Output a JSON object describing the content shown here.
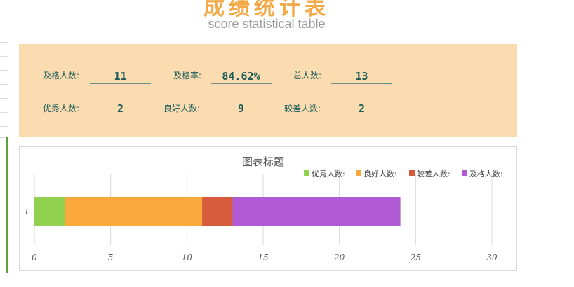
{
  "header": {
    "title": "成绩统计表",
    "subtitle": "score statistical table"
  },
  "stats": {
    "row1": [
      {
        "label": "及格人数:",
        "value": "11"
      },
      {
        "label": "及格率:",
        "value": "84.62%"
      },
      {
        "label": "总人数:",
        "value": "13"
      }
    ],
    "row2": [
      {
        "label": "优秀人数:",
        "value": "2"
      },
      {
        "label": "良好人数:",
        "value": "9"
      },
      {
        "label": "较差人数:",
        "value": "2"
      }
    ]
  },
  "colors": {
    "title": "#f4a947",
    "panel_background": "#fbdcb0",
    "stat_text": "#1d5c5a",
    "series": [
      "#92d050",
      "#f9a93b",
      "#d65a3c",
      "#b05ad6"
    ]
  },
  "chart_data": {
    "type": "bar",
    "orientation": "horizontal",
    "stacked": true,
    "title": "图表标题",
    "categories": [
      "1"
    ],
    "series": [
      {
        "name": "优秀人数:",
        "values": [
          2
        ]
      },
      {
        "name": "良好人数:",
        "values": [
          9
        ]
      },
      {
        "name": "较差人数:",
        "values": [
          2
        ]
      },
      {
        "name": "及格人数:",
        "values": [
          11
        ]
      }
    ],
    "xlim": [
      0,
      30
    ],
    "xticks": [
      "0",
      "5",
      "10",
      "15",
      "20",
      "25",
      "30"
    ],
    "grid": true,
    "legend": "top-right"
  }
}
